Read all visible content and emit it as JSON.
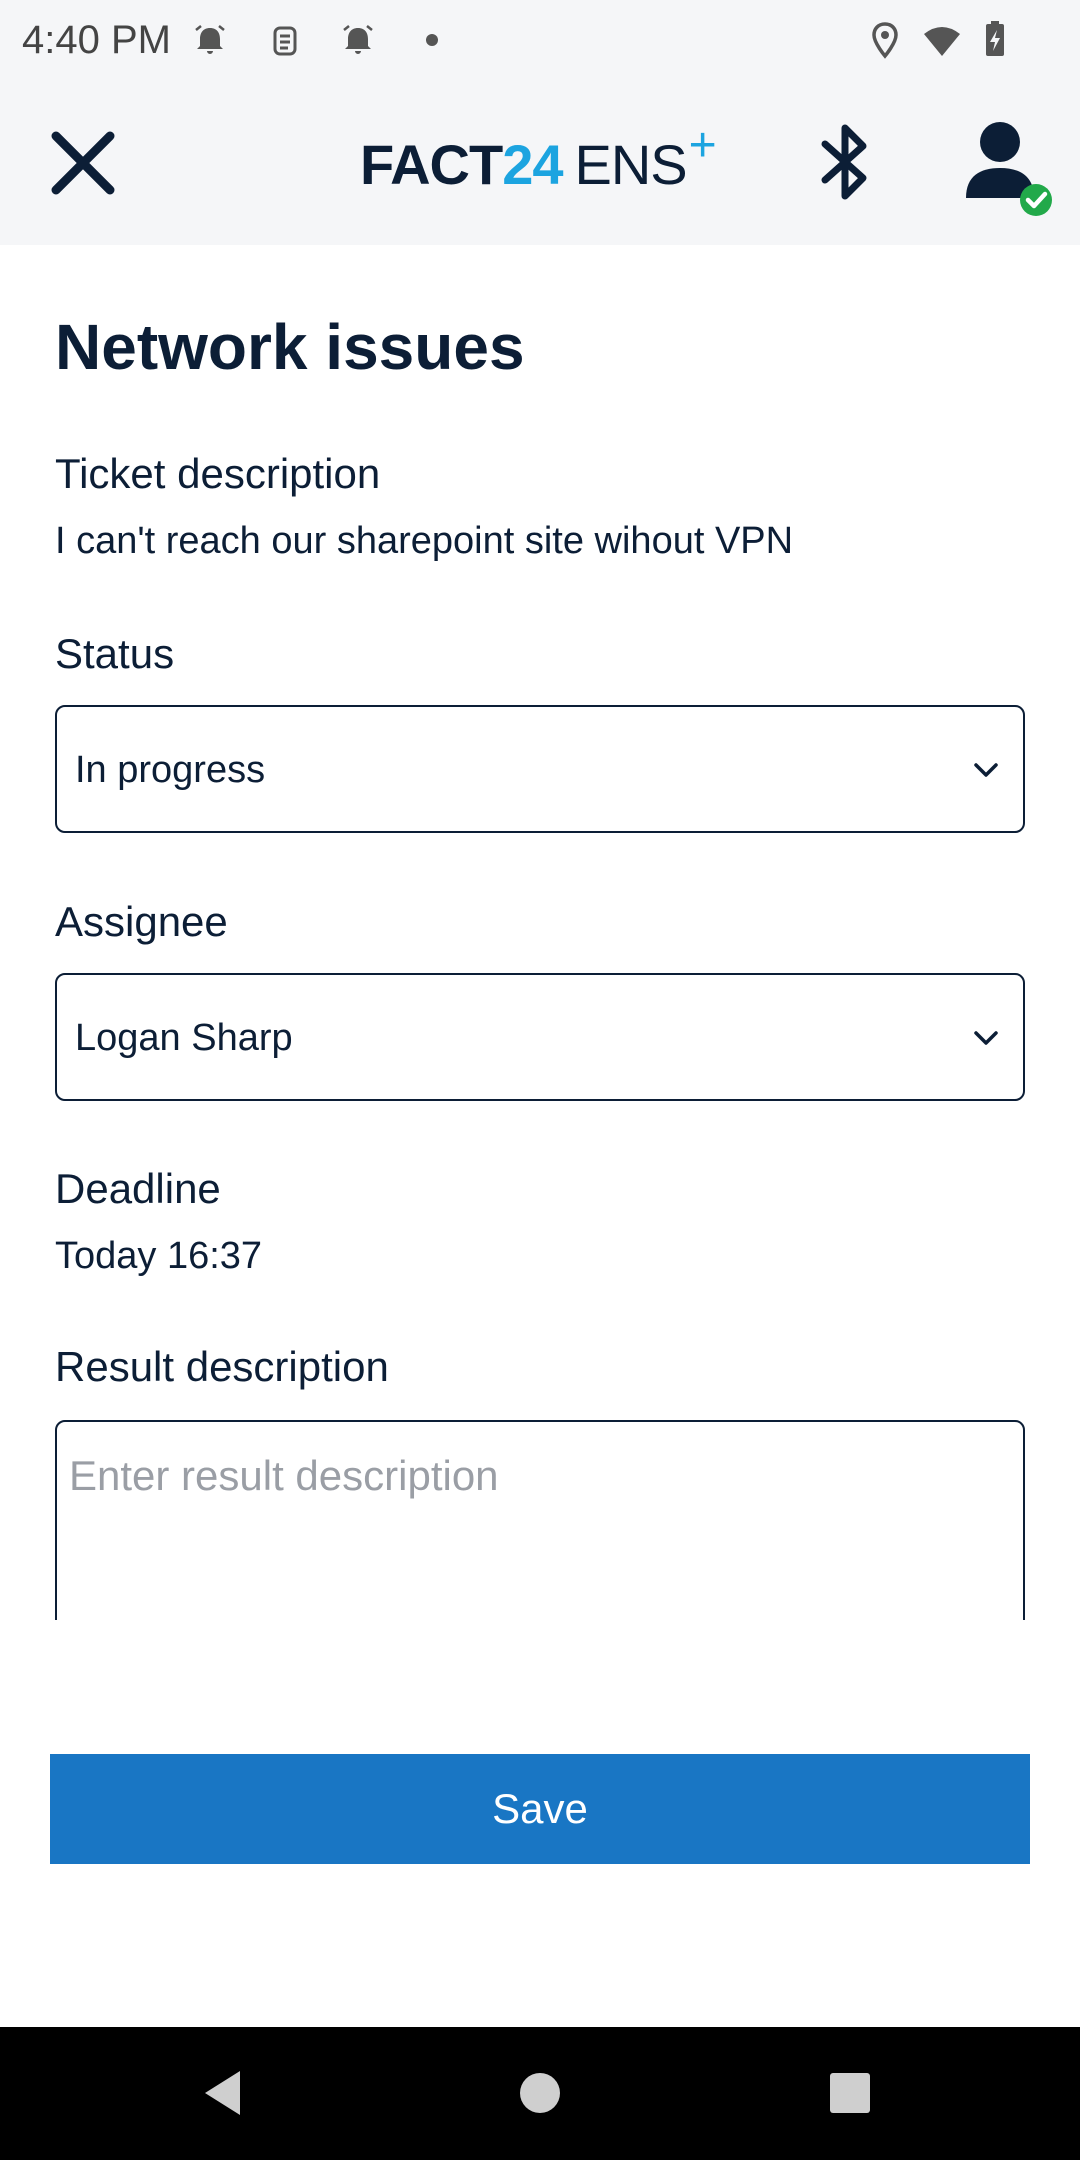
{
  "status_bar": {
    "time": "4:40 PM"
  },
  "app_bar": {
    "brand_fact": "FACT",
    "brand_num": "24",
    "brand_ens": "ENS",
    "brand_plus": "+"
  },
  "page": {
    "title": "Network issues"
  },
  "ticket": {
    "description_label": "Ticket description",
    "description_value": "I can't reach our sharepoint site wihout VPN",
    "status_label": "Status",
    "status_value": "In progress",
    "assignee_label": "Assignee",
    "assignee_value": "Logan Sharp",
    "deadline_label": "Deadline",
    "deadline_value": "Today 16:37",
    "result_label": "Result description",
    "result_placeholder": "Enter result description"
  },
  "actions": {
    "save_label": "Save"
  },
  "colors": {
    "primary": "#1976c4",
    "brand_accent": "#1ca4e0",
    "text": "#0c1e36",
    "online": "#22a94a"
  },
  "icons": {
    "close": "close-icon",
    "bluetooth": "bluetooth-icon",
    "user": "user-icon",
    "online_check": "check-badge-icon",
    "chevron": "chevron-down-icon"
  }
}
